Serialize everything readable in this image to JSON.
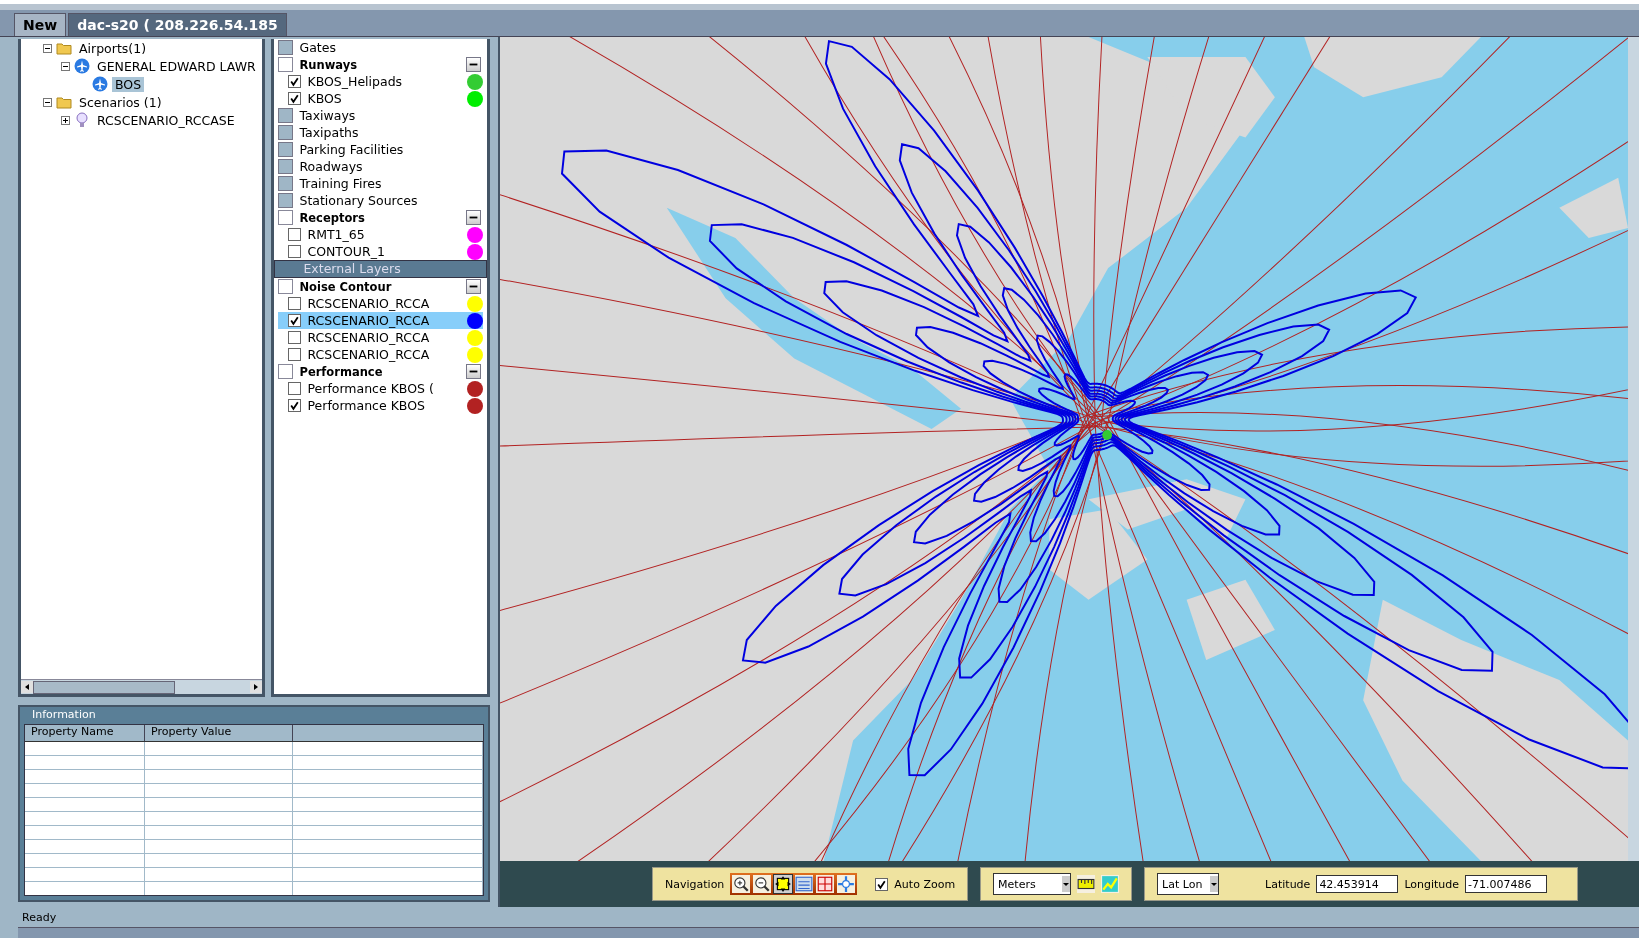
{
  "tabs": [
    {
      "label": "New",
      "selected": false
    },
    {
      "label": "dac-s20 ( 208.226.54.185",
      "selected": true
    }
  ],
  "tree": [
    {
      "label": "Airports(1)",
      "kind": "folder",
      "expanded": true,
      "selected": false,
      "children": [
        {
          "label": "GENERAL EDWARD LAWR",
          "kind": "airport",
          "expanded": true,
          "selected": false,
          "children": [
            {
              "label": "BOS",
              "kind": "airport",
              "selected": true
            }
          ]
        }
      ]
    },
    {
      "label": "Scenarios (1)",
      "kind": "folder",
      "expanded": true,
      "selected": false,
      "children": [
        {
          "label": "RCSCENARIO_RCCASE",
          "kind": "scenario",
          "expanded": false,
          "selected": false
        }
      ]
    }
  ],
  "layers": [
    {
      "kind": "disabled",
      "label": "Gates",
      "checked": false
    },
    {
      "kind": "group",
      "label": "Runways",
      "checked": false
    },
    {
      "kind": "layer",
      "label": "KBOS_Helipads",
      "checked": true,
      "selected": false,
      "color": "#33cc33"
    },
    {
      "kind": "layer",
      "label": "KBOS",
      "checked": true,
      "selected": false,
      "color": "#00ee00"
    },
    {
      "kind": "disabled",
      "label": "Taxiways",
      "checked": false
    },
    {
      "kind": "disabled",
      "label": "Taxipaths",
      "checked": false
    },
    {
      "kind": "disabled",
      "label": "Parking Facilities",
      "checked": false
    },
    {
      "kind": "disabled",
      "label": "Roadways",
      "checked": false
    },
    {
      "kind": "disabled",
      "label": "Training Fires",
      "checked": false
    },
    {
      "kind": "disabled",
      "label": "Stationary Sources",
      "checked": false
    },
    {
      "kind": "group",
      "label": "Receptors",
      "checked": false
    },
    {
      "kind": "layer",
      "label": "RMT1_65",
      "checked": false,
      "selected": false,
      "color": "#ff00ff"
    },
    {
      "kind": "layer",
      "label": "CONTOUR_1",
      "checked": false,
      "selected": false,
      "color": "#ff00ff"
    },
    {
      "kind": "section",
      "label": "External Layers"
    },
    {
      "kind": "group",
      "label": "Noise Contour",
      "checked": false
    },
    {
      "kind": "layer",
      "label": "RCSCENARIO_RCCA",
      "checked": false,
      "selected": false,
      "color": "#ffff00"
    },
    {
      "kind": "layer",
      "label": "RCSCENARIO_RCCA",
      "checked": true,
      "selected": true,
      "color": "#0000ff"
    },
    {
      "kind": "layer",
      "label": "RCSCENARIO_RCCA",
      "checked": false,
      "selected": false,
      "color": "#ffff00"
    },
    {
      "kind": "layer",
      "label": "RCSCENARIO_RCCA",
      "checked": false,
      "selected": false,
      "color": "#ffff00"
    },
    {
      "kind": "group",
      "label": "Performance",
      "checked": false
    },
    {
      "kind": "layer",
      "label": "Performance  KBOS (",
      "checked": false,
      "selected": false,
      "color": "#b22222"
    },
    {
      "kind": "layer",
      "label": "Performance KBOS",
      "checked": true,
      "selected": false,
      "color": "#b22222"
    }
  ],
  "information": {
    "title": "Information",
    "columns": [
      "Property Name",
      "Property Value"
    ]
  },
  "map_toolbar": {
    "navigation_label": "Navigation",
    "tools": [
      {
        "kind": "zoom-in",
        "selected": false
      },
      {
        "kind": "zoom-out",
        "selected": false
      },
      {
        "kind": "pan",
        "selected": true
      },
      {
        "kind": "layers",
        "selected": false
      },
      {
        "kind": "extent",
        "selected": false
      },
      {
        "kind": "center",
        "selected": false
      }
    ],
    "auto_zoom": {
      "label": "Auto Zoom",
      "checked": true
    },
    "units": "Meters",
    "coordinate_system": "Lat Lon",
    "latitude_label": "Latitude",
    "latitude": "42.453914",
    "longitude_label": "Longitude",
    "longitude": "-71.007486"
  },
  "status_bar": "Ready"
}
